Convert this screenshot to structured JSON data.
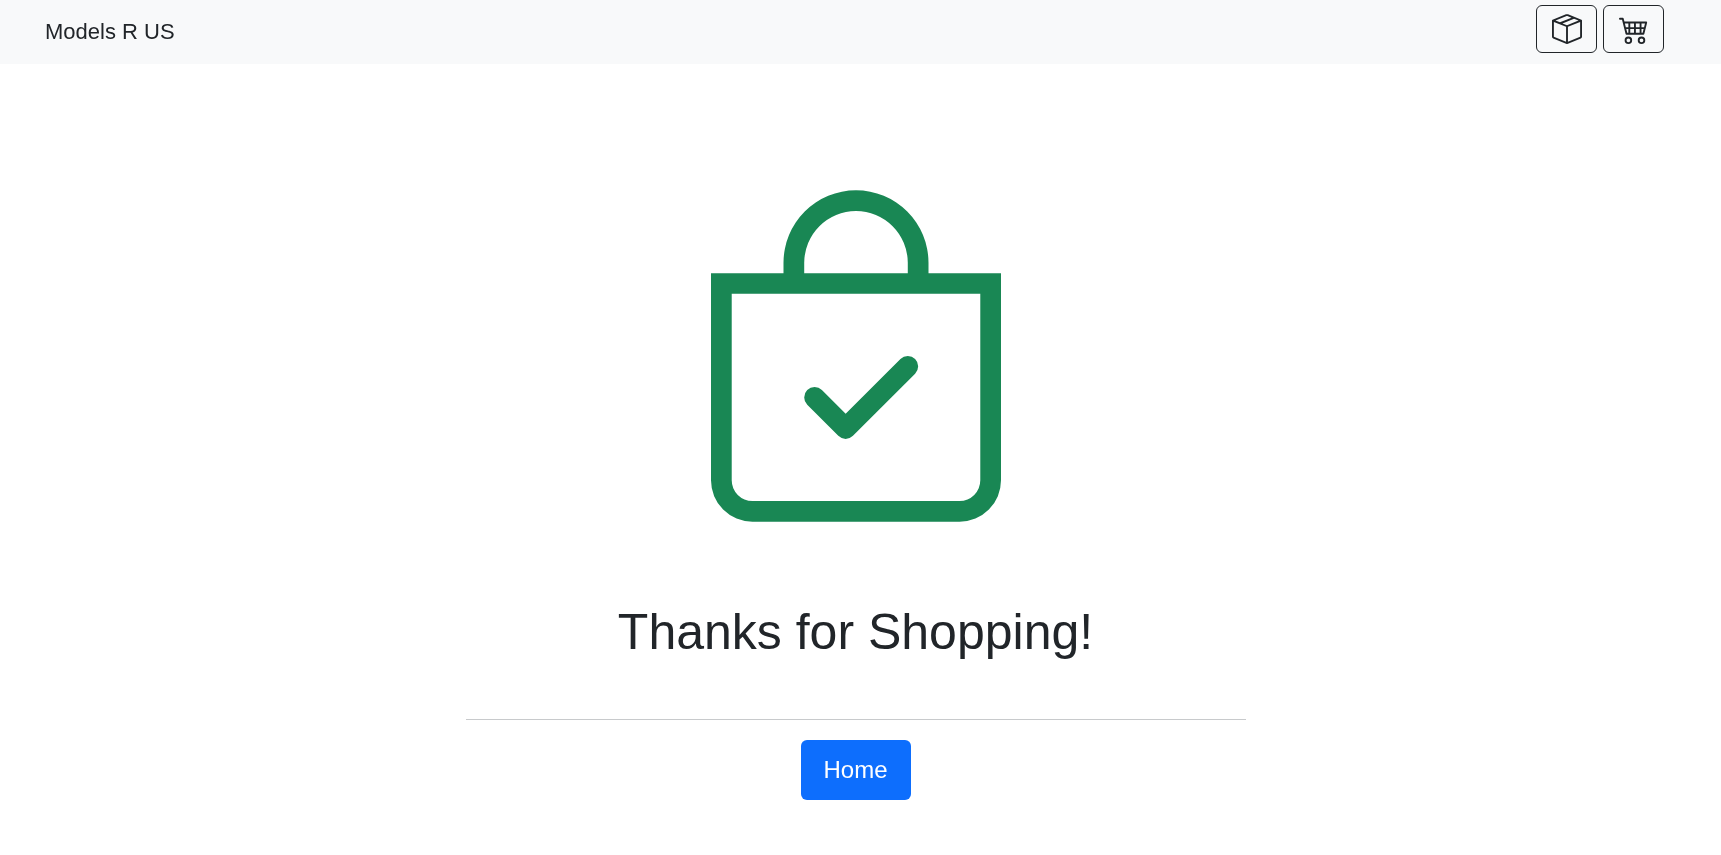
{
  "navbar": {
    "brand": "Models R US"
  },
  "confirmation": {
    "heading": "Thanks for Shopping!",
    "button": "Home"
  }
}
